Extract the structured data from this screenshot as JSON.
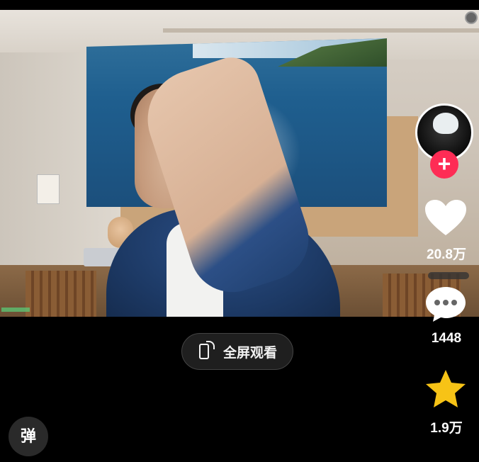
{
  "player": {
    "fullscreen_label": "全屏观看",
    "danmu_label": "弹"
  },
  "actions": {
    "like_count": "20.8万",
    "comment_count": "1448",
    "favorite_count": "1.9万",
    "follow_symbol": "+"
  },
  "icons": [
    "heart-icon",
    "comment-icon",
    "star-icon",
    "fullscreen-rotate-icon",
    "follow-plus-icon"
  ],
  "colors": {
    "follow_red": "#fe2c55",
    "star_yellow": "#f7c316",
    "heart_white": "#ffffff"
  }
}
